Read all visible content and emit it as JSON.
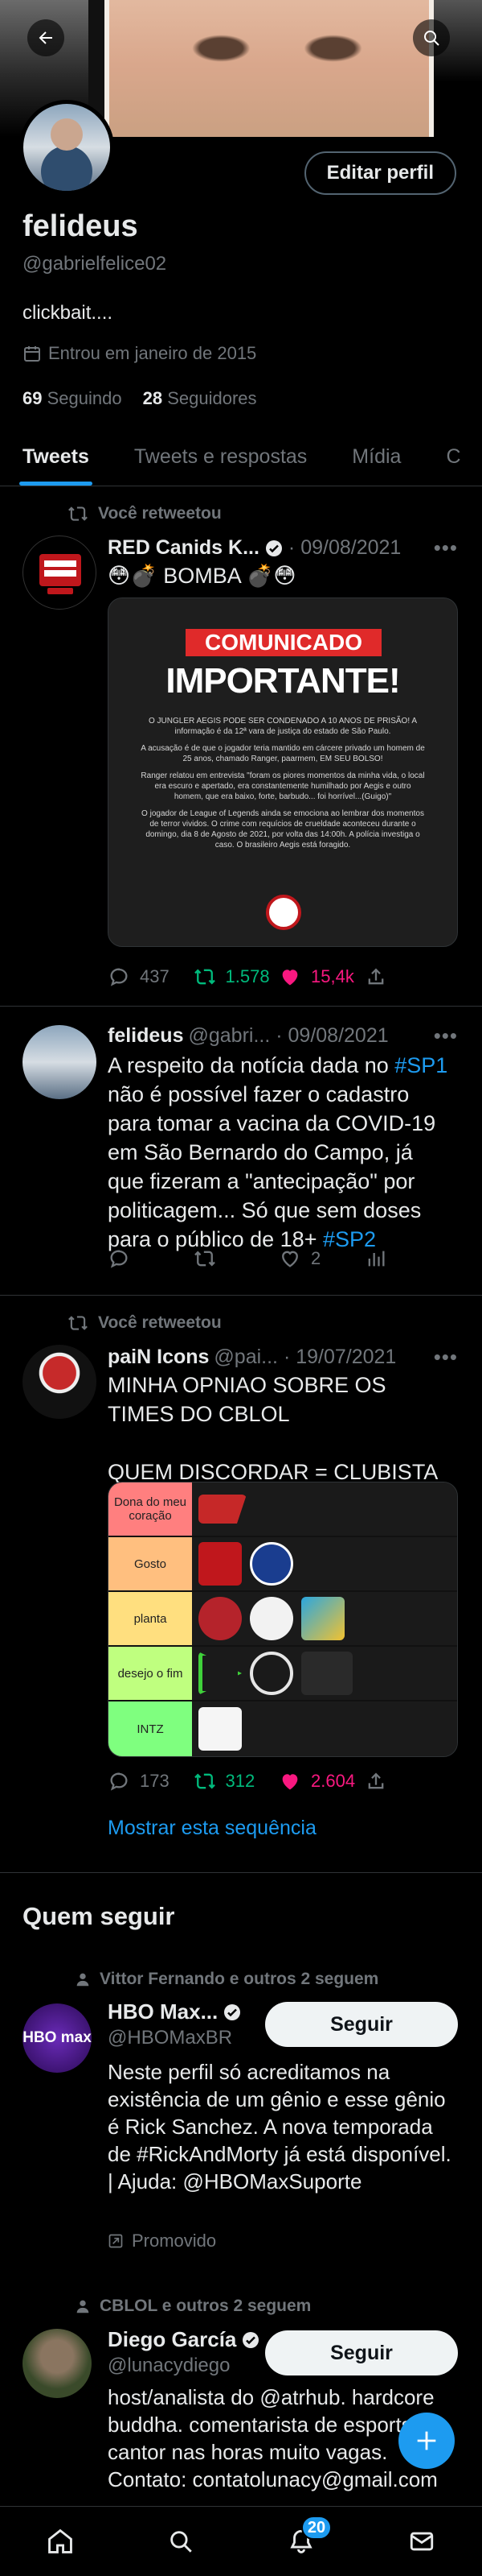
{
  "profile": {
    "name": "felideus",
    "handle": "@gabrielfelice02",
    "bio": "clickbait....",
    "joined": "Entrou em janeiro de 2015",
    "following_count": "69",
    "following_label": "Seguindo",
    "followers_count": "28",
    "followers_label": "Seguidores",
    "edit_label": "Editar perfil"
  },
  "tabs": [
    "Tweets",
    "Tweets e respostas",
    "Mídia",
    "C"
  ],
  "tweets": [
    {
      "retweet_label": "Você retweetou",
      "name": "RED Canids K...",
      "meta": "· 09/08/2021",
      "text": "😳💣 BOMBA 💣😳",
      "media": {
        "badge": "COMUNICADO",
        "headline": "IMPORTANTE!",
        "paragraphs": [
          "O JUNGLER AEGIS PODE SER CONDENADO A 10 ANOS DE PRISÃO! A informação é da 12ª vara de justiça do estado de São Paulo.",
          "A acusação é de que o jogador teria mantido em cárcere privado um homem de 25 anos, chamado Ranger, paarmem, EM SEU BOLSO!",
          "Ranger relatou em entrevista \"foram os piores momentos da minha vida, o local era escuro e apertado, era constantemente humilhado por Aegis e outro homem, que era baixo, forte, barbudo... foi horrível...(Guigo)\"",
          "O jogador de League of Legends ainda se emociona ao lembrar dos momentos de terror vividos. O crime com requícios de crueldade aconteceu durante o domingo, dia 8 de Agosto de 2021, por volta das 14:00h. A polícia investiga o caso. O brasileiro Aegis está foragido."
        ]
      },
      "replies": "437",
      "retweets": "1.578",
      "likes": "15,4k"
    },
    {
      "name": "felideus",
      "meta": "@gabri... · 09/08/2021",
      "text_parts": [
        "A respeito da notícia dada no ",
        "#SP1",
        " não é possível fazer o cadastro para tomar a vacina da COVID-19 em São Bernardo do Campo, já que fizeram a \"antecipação\" por politicagem... Só que sem doses para o público de 18+ ",
        "#SP2"
      ],
      "likes": "2"
    },
    {
      "retweet_label": "Você retweetou",
      "name": "paiN Icons",
      "meta": "@pai... · 19/07/2021",
      "text_line1": "MINHA OPNIAO SOBRE OS TIMES DO CBLOL",
      "text_line2": "QUEM DISCORDAR = CLUBISTA",
      "tier_labels": [
        "Dona do meu coração",
        "Gosto",
        "planta",
        "desejo o fim",
        "INTZ"
      ],
      "replies": "173",
      "retweets": "312",
      "likes": "2.604",
      "show_thread": "Mostrar esta sequência"
    }
  ],
  "who_to_follow": {
    "title": "Quem seguir",
    "follow_label": "Seguir",
    "suggestions": [
      {
        "context": "Vittor Fernando e outros 2 seguem",
        "name": "HBO Max...",
        "handle": "@HBOMaxBR",
        "bio": "Neste perfil só acreditamos na existência de um gênio e esse gênio é Rick Sanchez. A nova temporada de #RickAndMorty já está disponível. | Ajuda: @HBOMaxSuporte",
        "promoted": "Promovido",
        "avatar_text": "HBO max"
      },
      {
        "context": "CBLOL e outros 2 seguem",
        "name": "Diego García",
        "handle": "@lunacydiego",
        "bio": "host/analista do @atrhub. hardcore buddha. comentarista de esports. cantor nas horas muito vagas. Contato: contatolunacy@gmail.com"
      }
    ]
  },
  "nav": {
    "notifications_badge": "20"
  },
  "colors": {
    "accent": "#1d9bf0",
    "retweet_green": "#00ba7c",
    "like_pink": "#f91880",
    "background": "#000000"
  }
}
